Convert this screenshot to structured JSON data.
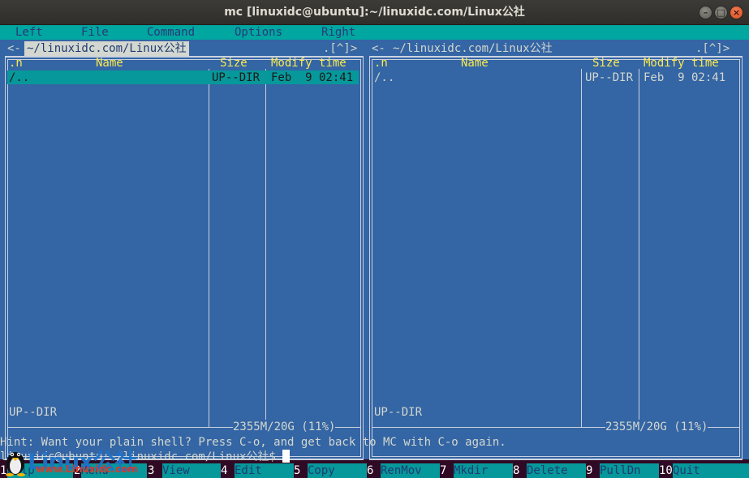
{
  "window": {
    "title": "mc [linuxidc@ubuntu]:~/linuxidc.com/Linux公社"
  },
  "menubar": [
    "Left",
    "File",
    "Command",
    "Options",
    "Right"
  ],
  "left_panel": {
    "header_left": "<-",
    "path": "~/linuxidc.com/Linux公社",
    "header_right": ".[^]>",
    "columns": {
      "n": ".n",
      "name": "Name",
      "size": "Size",
      "modify": "Modify time"
    },
    "rows": [
      {
        "name": "/..",
        "size": "UP--DIR",
        "modify": "Feb  9 02:41"
      }
    ],
    "mini_status": "UP--DIR",
    "free_space": "2355M/20G (11%)"
  },
  "right_panel": {
    "header_left": "<-",
    "path": "~/linuxidc.com/Linux公社",
    "header_right": ".[^]>",
    "columns": {
      "n": ".n",
      "name": "Name",
      "size": "Size",
      "modify": "Modify time"
    },
    "rows": [
      {
        "name": "/..",
        "size": "UP--DIR",
        "modify": "Feb  9 02:41"
      }
    ],
    "mini_status": "UP--DIR",
    "free_space": "2355M/20G (11%)"
  },
  "hint": "Hint: Want your plain shell? Press C-o, and get back to MC with C-o again.",
  "prompt": "linuxidc@ubuntu:~/linuxidc.com/Linux公社$ ",
  "fkeys": [
    {
      "num": "1",
      "label": "Help"
    },
    {
      "num": "2",
      "label": "Menu"
    },
    {
      "num": "3",
      "label": "View"
    },
    {
      "num": "4",
      "label": "Edit"
    },
    {
      "num": "5",
      "label": "Copy"
    },
    {
      "num": "6",
      "label": "RenMov"
    },
    {
      "num": "7",
      "label": "Mkdir"
    },
    {
      "num": "8",
      "label": "Delete"
    },
    {
      "num": "9",
      "label": "PullDn"
    },
    {
      "num": "10",
      "label": "Quit"
    }
  ],
  "watermark": {
    "logo_text": "Linux公社",
    "url": "www.Linuxidc.com"
  },
  "colors": {
    "panel_bg": "#3465a4",
    "menubar_bg": "#00a6a0",
    "header_text": "#fce94f",
    "selection": "#06989a",
    "terminal_bg": "#300a24"
  }
}
